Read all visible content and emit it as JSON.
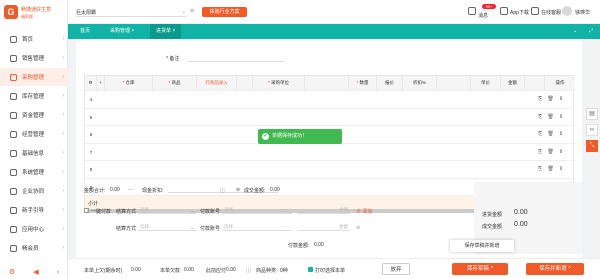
{
  "brand": {
    "name": "畅捷通好生意",
    "sub": "福利版"
  },
  "sidebar": {
    "items": [
      {
        "label": "首页",
        "icon": "home-icon"
      },
      {
        "label": "销售管理",
        "icon": "sales-icon"
      },
      {
        "label": "采购管理",
        "icon": "purchase-icon"
      },
      {
        "label": "库存管理",
        "icon": "warehouse-icon"
      },
      {
        "label": "资金管理",
        "icon": "money-icon"
      },
      {
        "label": "经营管理",
        "icon": "chart-icon"
      },
      {
        "label": "基础信息",
        "icon": "info-icon"
      },
      {
        "label": "系统管理",
        "icon": "gear-icon"
      },
      {
        "label": "企业协同",
        "icon": "team-icon"
      },
      {
        "label": "新手引导",
        "icon": "guide-icon"
      },
      {
        "label": "应用中心",
        "icon": "apps-icon"
      },
      {
        "label": "畅会员",
        "icon": "member-icon"
      }
    ],
    "active_index": 2
  },
  "header": {
    "store": "巨太阳霸",
    "open_store_button": "体验行业方案",
    "notify": "消息",
    "notify_badge": "99+",
    "app_download": "App下载",
    "online_service": "在线客服",
    "user": "徐瑛华"
  },
  "tabs": [
    {
      "label": "首页"
    },
    {
      "label": "采购管理 ×"
    },
    {
      "label": "进货单 ×"
    }
  ],
  "form": {
    "remark_label": "* 备注"
  },
  "table": {
    "headers": [
      "",
      "* 仓库",
      "* 商品",
      "行商品录入",
      "",
      "* 采购单位",
      "* 数量",
      "报价",
      "折扣%",
      "",
      "单价",
      "金额",
      "",
      "操作"
    ],
    "row_numbers": [
      "4",
      "5",
      "6",
      "7",
      "8",
      "9"
    ],
    "row_actions": "⎘ 🗑 ▯",
    "subtotal_label": "小计"
  },
  "toast": {
    "text": "单据保存成功！"
  },
  "totals": {
    "amount_total_label": "金额合计:",
    "amount_total": "0.00",
    "discount_label": "现金折扣:",
    "deal_label": "成交金额:",
    "deal_amount": "0.00"
  },
  "payment": {
    "once_label": "一键付款",
    "settle_label": "结算方式",
    "settle_placeholder": "选择...",
    "pay_account_label": "付款账号",
    "pay_account_placeholder": "选择...",
    "amount_label": "金额",
    "add_label": "添加",
    "settle2_label": "结算方式",
    "settle2_placeholder": "选择...",
    "pay_account2_label": "付款账号",
    "pay_account2_placeholder": "选择...",
    "amount2_label": "金额",
    "paid_label": "付款金额:",
    "paid_amount": "0.00"
  },
  "summary": {
    "stock_label": "进货金额",
    "stock_value": "0.00",
    "deal_label": "成交金额",
    "deal_value": "0.00"
  },
  "save_reset_menu": "保存草稿并新增",
  "footer": {
    "prev_debt_label": "本单上欠(期余时)",
    "prev_debt": "0.00",
    "this_debt_label": "本单欠款",
    "this_debt": "0.00",
    "this_paid_label": "此前应付",
    "this_paid": "0.00",
    "print_label": "商品种类:",
    "print_value": "0种",
    "after_print_label": "打印选择本单",
    "abandon_button": "放弃",
    "save_draft_button": "保存草稿",
    "save_new_button": "保存并新增"
  },
  "colors": {
    "accent": "#f05a28",
    "teal": "#10b3a5",
    "success": "#3fb950"
  }
}
